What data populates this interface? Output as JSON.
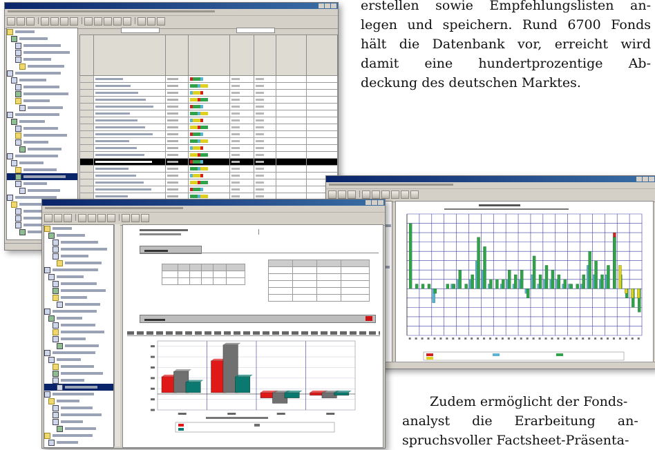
{
  "article": {
    "top_lines": [
      "erstellen sowie Empfehlungslisten an-",
      "legen und speichern. Rund 6700 Fonds",
      "hält die Datenbank vor, erreicht wird",
      "damit eine hundertprozentige Ab-",
      "deckung des deutschen Marktes."
    ],
    "bottom_lines": [
      "Zudem ermöglicht der Fonds-",
      "analyst die Erarbeitung an-",
      "spruchsvoller Factsheet-Präsenta-"
    ]
  },
  "screens": {
    "fund_list": {
      "row_count": 26,
      "highlighted_row": 12
    },
    "performance_chart": {
      "colors": {
        "red": "#d42020",
        "cyan": "#5ab4d2",
        "green": "#2fa24a",
        "yellow": "#e0d020",
        "grid": "#3a3aa0"
      }
    },
    "factsheet": {
      "colors": {
        "red": "#e01818",
        "gray": "#707070",
        "teal": "#0a7a70"
      }
    }
  },
  "chart_data": [
    {
      "type": "bar",
      "categories": [
        "1",
        "2",
        "3",
        "4",
        "5",
        "6",
        "7",
        "8",
        "9",
        "10",
        "11",
        "12",
        "13",
        "14",
        "15",
        "16",
        "17",
        "18",
        "19",
        "20",
        "21",
        "22",
        "23",
        "24",
        "25",
        "26",
        "27",
        "28",
        "29",
        "30",
        "31",
        "32",
        "33",
        "34",
        "35",
        "36",
        "37",
        "38"
      ],
      "series": [
        {
          "values": [
            14,
            1,
            1,
            1,
            -1,
            0,
            1,
            1,
            4,
            1,
            3,
            11,
            9,
            2,
            2,
            2,
            4,
            3,
            4,
            -2,
            7,
            3,
            5,
            4,
            3,
            2,
            1,
            1,
            3,
            8,
            6,
            3,
            5,
            11,
            3,
            -2,
            -4,
            -5
          ]
        },
        {
          "values": [
            0,
            0,
            0,
            0,
            -3,
            0,
            0,
            1,
            2,
            0,
            2,
            6,
            4,
            1,
            0,
            1,
            2,
            1,
            2,
            -1,
            3,
            1,
            2,
            2,
            2,
            1,
            1,
            0,
            1,
            5,
            3,
            2,
            3,
            0,
            0,
            0,
            0,
            0
          ]
        },
        {
          "values": [
            0,
            0,
            0,
            0,
            0,
            0,
            0,
            0,
            0,
            0,
            0,
            0,
            0,
            0,
            0,
            0,
            0,
            0,
            0,
            0,
            0,
            0,
            0,
            0,
            0,
            0,
            0,
            0,
            0,
            0,
            0,
            0,
            0,
            12,
            0,
            0,
            0,
            0
          ]
        },
        {
          "values": [
            0,
            0,
            0,
            0,
            0,
            0,
            0,
            0,
            0,
            0,
            0,
            0,
            0,
            0,
            0,
            0,
            0,
            0,
            0,
            0,
            0,
            0,
            0,
            0,
            0,
            0,
            0,
            0,
            0,
            0,
            0,
            0,
            0,
            0,
            5,
            -1,
            -2,
            -2
          ]
        }
      ],
      "ylim": [
        -10,
        16
      ]
    },
    {
      "type": "bar",
      "categories": [
        "1",
        "2",
        "3",
        "4"
      ],
      "series": [
        {
          "values": [
            3,
            6,
            -1,
            -0.5
          ]
        },
        {
          "values": [
            4,
            9,
            -2,
            -1
          ]
        },
        {
          "values": [
            2,
            3,
            -1,
            -0.5
          ]
        }
      ],
      "ylim": [
        -3,
        10
      ]
    }
  ]
}
